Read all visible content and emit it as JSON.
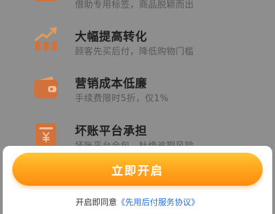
{
  "colors": {
    "overlay_background": "#8e8e8e",
    "icon_orange": "#d1713b",
    "button_gradient_top": "#ffc533",
    "button_gradient_bottom": "#ff8d0f",
    "link_blue": "#2f6fd6"
  },
  "features": [
    {
      "title": "",
      "desc": "借助专用标签，商品脱颖而出",
      "icon": "tag-icon"
    },
    {
      "title": "大幅提高转化",
      "desc": "顾客先买后付，降低购物门槛",
      "icon": "growth-chart-icon"
    },
    {
      "title": "营销成本低廉",
      "desc": "手续费限时5折，仅1%",
      "icon": "wallet-icon"
    },
    {
      "title": "坏账平台承担",
      "desc": "坏账平台全包，杜绝逾期风险",
      "icon": "invoice-icon"
    }
  ],
  "cta": {
    "label": "立即开启"
  },
  "agreement": {
    "prefix": "开启即同意",
    "link": "《先用后付服务协议》"
  }
}
